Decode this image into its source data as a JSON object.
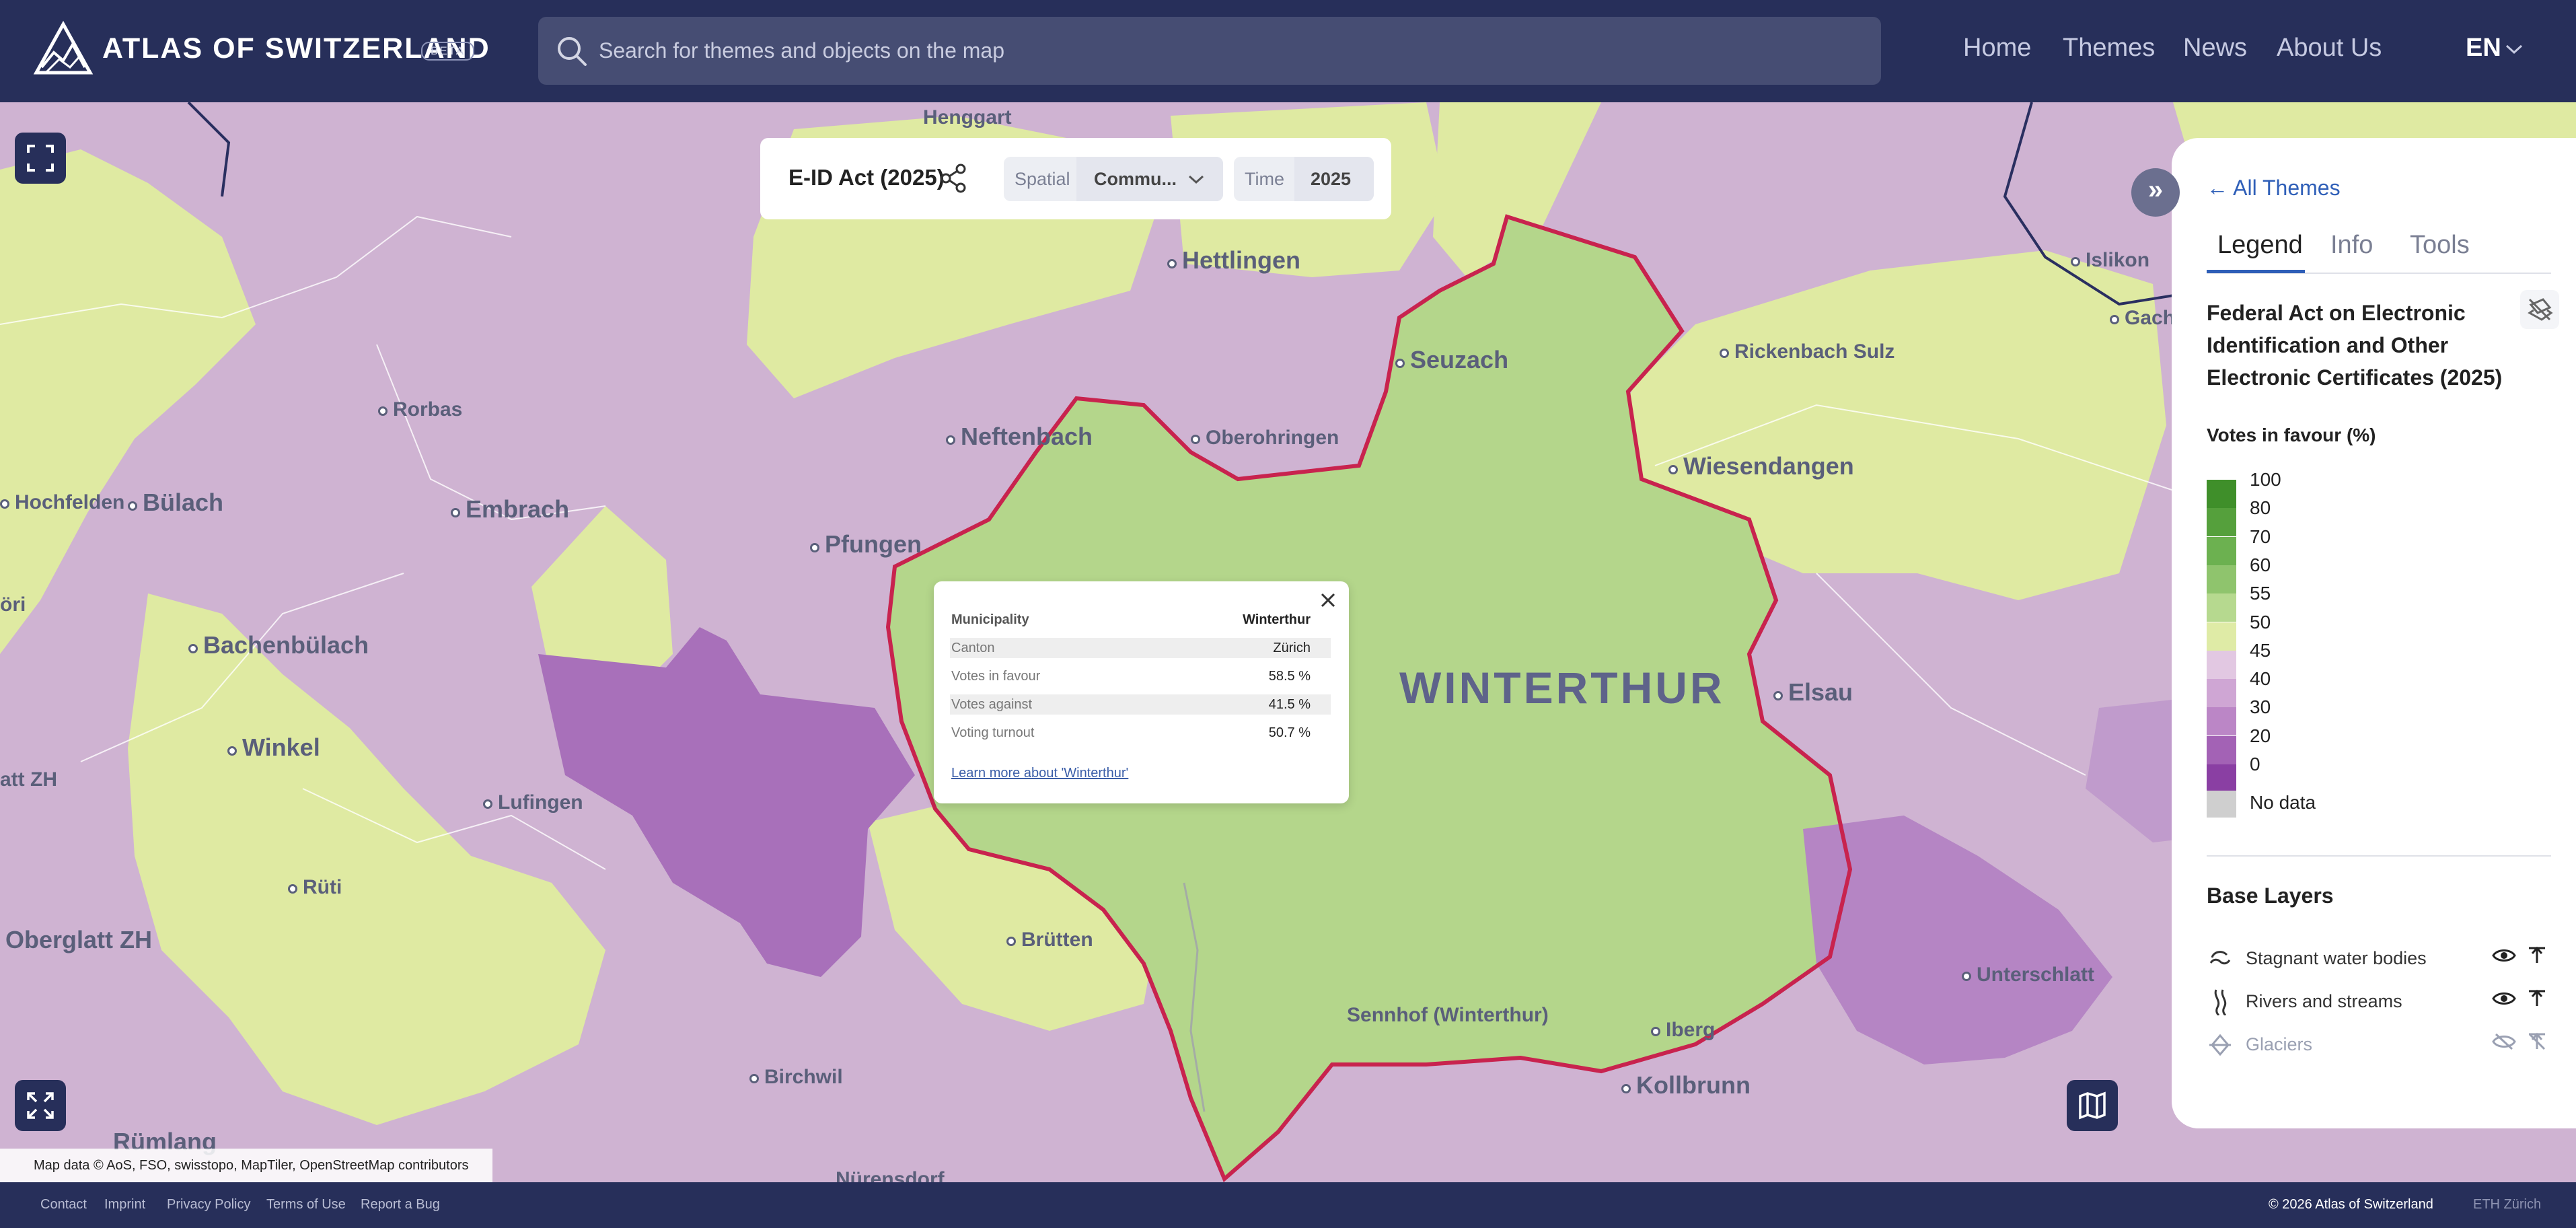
{
  "header": {
    "brand": "ATLAS OF SWITZERLAND",
    "beta": "BETA",
    "search_placeholder": "Search for themes and objects on the map",
    "nav": [
      "Home",
      "Themes",
      "News",
      "About Us"
    ],
    "language": "EN"
  },
  "theme_bar": {
    "title": "E-ID Act (2025)",
    "spatial_label": "Spatial",
    "spatial_value": "Commu...",
    "time_label": "Time",
    "time_value": "2025"
  },
  "map": {
    "places": {
      "henggart": "Henggart",
      "hettlingen": "Hettlingen",
      "seuzach": "Seuzach",
      "rickenbach": "Rickenbach Sulz",
      "islikon": "Islikon",
      "gachn": "Gachn",
      "rorbas": "Rorbas",
      "neftenbach": "Neftenbach",
      "oberohringen": "Oberohringen",
      "wiesendangen": "Wiesendangen",
      "hochfelden": "Hochfelden",
      "bulach": "Bülach",
      "embrach": "Embrach",
      "pfungen": "Pfungen",
      "bachenbulach": "Bachenbülach",
      "winkel": "Winkel",
      "lufingen": "Lufingen",
      "ruti": "Rüti",
      "oberglatt": "Oberglatt ZH",
      "brutten": "Brütten",
      "winterthur": "WINTERTHUR",
      "elsau": "Elsau",
      "sennhof": "Sennhof (Winterthur)",
      "iberg": "Iberg",
      "kollbrunn": "Kollbrunn",
      "unterschlatt": "Unterschlatt",
      "birchwil": "Birchwil",
      "rumlang": "Rümlang",
      "nurensdorf": "Nürensdorf",
      "oori": "öri",
      "attzh": "att ZH"
    },
    "attribution": "Map data © AoS, FSO, swisstopo, MapTiler, OpenStreetMap contributors"
  },
  "popup": {
    "rows": [
      {
        "key": "Municipality",
        "value": "Winterthur"
      },
      {
        "key": "Canton",
        "value": "Zürich"
      },
      {
        "key": "Votes in favour",
        "value": "58.5 %"
      },
      {
        "key": "Votes against",
        "value": "41.5 %"
      },
      {
        "key": "Voting turnout",
        "value": "50.7 %"
      }
    ],
    "link": "Learn more about 'Winterthur'"
  },
  "panel": {
    "back_link": "All Themes",
    "tabs": [
      "Legend",
      "Info",
      "Tools"
    ],
    "active_tab": "Legend",
    "title": "Federal Act on Electronic Identification and Other Electronic Certificates (2025)",
    "legend_subtitle": "Votes in favour (%)",
    "scale": [
      {
        "label": "100",
        "color": "#3f8f2a"
      },
      {
        "label": "80",
        "color": "#55a03c"
      },
      {
        "label": "70",
        "color": "#6cb150"
      },
      {
        "label": "60",
        "color": "#8fc46d"
      },
      {
        "label": "55",
        "color": "#b6d98f"
      },
      {
        "label": "50",
        "color": "#dfeba6"
      },
      {
        "label": "45",
        "color": "#e2c8e2"
      },
      {
        "label": "40",
        "color": "#cfa6d4"
      },
      {
        "label": "30",
        "color": "#bb86c6"
      },
      {
        "label": "20",
        "color": "#a362b5"
      },
      {
        "label": "0",
        "color": "#8a3fa3"
      }
    ],
    "no_data": "No data",
    "base_layers_title": "Base Layers",
    "base_layers": [
      {
        "label": "Stagnant water bodies",
        "icon": "water-icon",
        "visible": true
      },
      {
        "label": "Rivers and streams",
        "icon": "river-icon",
        "visible": true
      },
      {
        "label": "Glaciers",
        "icon": "glacier-icon",
        "visible": false
      }
    ]
  },
  "footer": {
    "links": [
      "Contact",
      "Imprint",
      "Privacy Policy",
      "Terms of Use",
      "Report a Bug"
    ],
    "copyright": "© 2026 Atlas of Switzerland",
    "eth": "ETH Zürich"
  },
  "colors": {
    "header_bg": "#272f5a",
    "accent": "#2f5fb8",
    "boundary": "#c8234e",
    "favour_green": "#b4d88c",
    "against_purple": "#cfa8d4"
  }
}
